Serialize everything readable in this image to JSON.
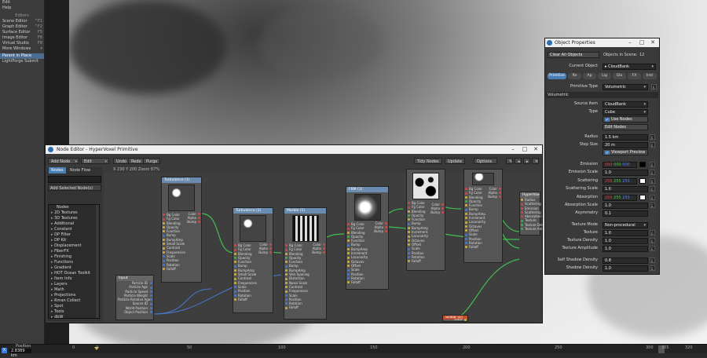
{
  "left_panel": {
    "top_items": [
      {
        "label": "Edit"
      },
      {
        "label": "Help"
      }
    ],
    "editors_heading": "Editors",
    "editors": [
      {
        "label": "Scene Editor",
        "key": "^F1"
      },
      {
        "label": "Graph Editor",
        "key": "^F2"
      },
      {
        "label": "Surface Editor",
        "key": "F5"
      },
      {
        "label": "Image Editor",
        "key": "F6"
      },
      {
        "label": "Virtual Studio",
        "key": "F8"
      },
      {
        "label": "More Windows",
        "key": "▾"
      }
    ],
    "plugins": [
      {
        "label": "Parent in Place"
      },
      {
        "label": "LightForge Submit"
      }
    ]
  },
  "node_editor": {
    "title": "Node Editor - HyperVoxel Primitive",
    "add_node": "Add Node",
    "edit": "Edit",
    "undo": "Undo",
    "redo": "Redo",
    "purge": "Purge",
    "tidy_nodes": "Tidy Nodes",
    "update": "Update",
    "options": "Options",
    "coords": "X 230 Y 200 Zoom 87%",
    "tabs": [
      "Nodes",
      "Node Flow"
    ],
    "add_selected": "Add Selected Node(s)",
    "list_header": "Nodes",
    "categories": [
      "2D Textures",
      "3D Textures",
      "Additional",
      "Constant",
      "DP Filter",
      "DP Kit",
      "Displacement",
      "FiberFX",
      "Finishing",
      "Functions",
      "Gradient",
      "HOT Ocean Toolkit",
      "Item Info",
      "Layers",
      "Math",
      "Projections",
      "Rman Collect",
      "Spot",
      "Tools",
      "dbW"
    ],
    "nodes": {
      "turb1": "Turbulence (1)",
      "turb2": "Turbulence (2)",
      "marble": "Marble (1)",
      "fbm": "FBM (1)",
      "hv": "HyperVoxel",
      "input": "Input",
      "scalar": "Scalar (1)",
      "scalar_out": "Scalar"
    },
    "tex_inputs": [
      "Bg Color",
      "Fg Color",
      "Blending",
      "Opacity",
      "Function",
      "Bump",
      "BumpAmp",
      "Small Scale",
      "Contrast",
      "Frequencies",
      "Scale",
      "Position",
      "Rotation",
      "Falloff"
    ],
    "marble_inputs": [
      "Bg Color",
      "Fg Color",
      "Blending",
      "Opacity",
      "Function",
      "Bump",
      "BumpAmp",
      "Vein Spacing",
      "Distortion",
      "Noise Scale",
      "Contrast",
      "Frequencies",
      "Scale",
      "Position",
      "Rotation",
      "Falloff"
    ],
    "fbm_inputs": [
      "Bg Color",
      "Fg Color",
      "Blending",
      "Opacity",
      "Function",
      "Bump",
      "BumpAmp",
      "Increment",
      "Lacunarity",
      "Octaves",
      "Offset",
      "Scale",
      "Position",
      "Rotation",
      "Falloff"
    ],
    "outputs": [
      "Color",
      "Alpha",
      "Bump"
    ],
    "hv_inputs": [
      "Radius",
      "Scattering",
      "Emission",
      "Scattering",
      "Absorption",
      "Texture",
      "Texture Den",
      "Texture Am"
    ],
    "input_outputs": [
      "Particle ID",
      "Particle Age",
      "Particle Speed",
      "Particle Weight",
      "Particle Relative Age",
      "Source ID",
      "World Position",
      "Object Position"
    ]
  },
  "object_properties": {
    "title": "Object Properties",
    "clear_all": "Clear All Objects",
    "objects_in_scene_label": "Objects in Scene:",
    "objects_in_scene": "12",
    "current_object_label": "Current Object",
    "current_object": "CloudBank",
    "tabs": [
      "Primitive",
      "Re",
      "Ap",
      "Lig",
      "Glo",
      "FX",
      "Inst"
    ],
    "primitive_type_label": "Primitive Type",
    "primitive_type": "Volumetric",
    "section": "Volumetric",
    "source_item_label": "Source Item",
    "source_item": "CloudBank",
    "type_label": "Type",
    "type": "Cube",
    "use_nodes": "Use Nodes",
    "edit_nodes": "Edit Nodes",
    "radius_label": "Radius",
    "radius": "1.5 km",
    "step_size_label": "Step Size",
    "step_size": "20 m",
    "viewport_preview": "Viewport Preview",
    "emission_label": "Emission",
    "emission": [
      "000",
      "000",
      "000"
    ],
    "emission_scale_label": "Emission Scale",
    "emission_scale": "1.0",
    "scattering_label": "Scattering",
    "scattering": [
      "255",
      "255",
      "255"
    ],
    "scattering_scale_label": "Scattering Scale",
    "scattering_scale": "1.0",
    "absorption_label": "Absorption",
    "absorption": [
      "255",
      "255",
      "255"
    ],
    "absorption_scale_label": "Absorption Scale",
    "absorption_scale": "1.0",
    "asymmetry_label": "Asymmetry",
    "asymmetry": "0.1",
    "texture_mode_label": "Texture Mode",
    "texture_mode": "Non-procedural",
    "texture_label": "Texture",
    "texture": "1.0",
    "texture_density_label": "Texture Density",
    "texture_density": "1.0",
    "texture_amplitude_label": "Texture Amplitude",
    "texture_amplitude": "1.0",
    "self_shadow_label": "Self Shadow Density",
    "self_shadow": "0.8",
    "shadow_density_label": "Shadow Density",
    "shadow_density": "1.0"
  },
  "timeline": {
    "axis_label": "X",
    "position_label": "Position",
    "position": "2.8389 km",
    "ticks": [
      "0",
      "0",
      "50",
      "100",
      "150",
      "200",
      "250",
      "300",
      "305",
      "320"
    ]
  },
  "colors": {
    "accent": "#4a7fb5",
    "selection": "#4d6d93",
    "wire": "#40c050"
  }
}
